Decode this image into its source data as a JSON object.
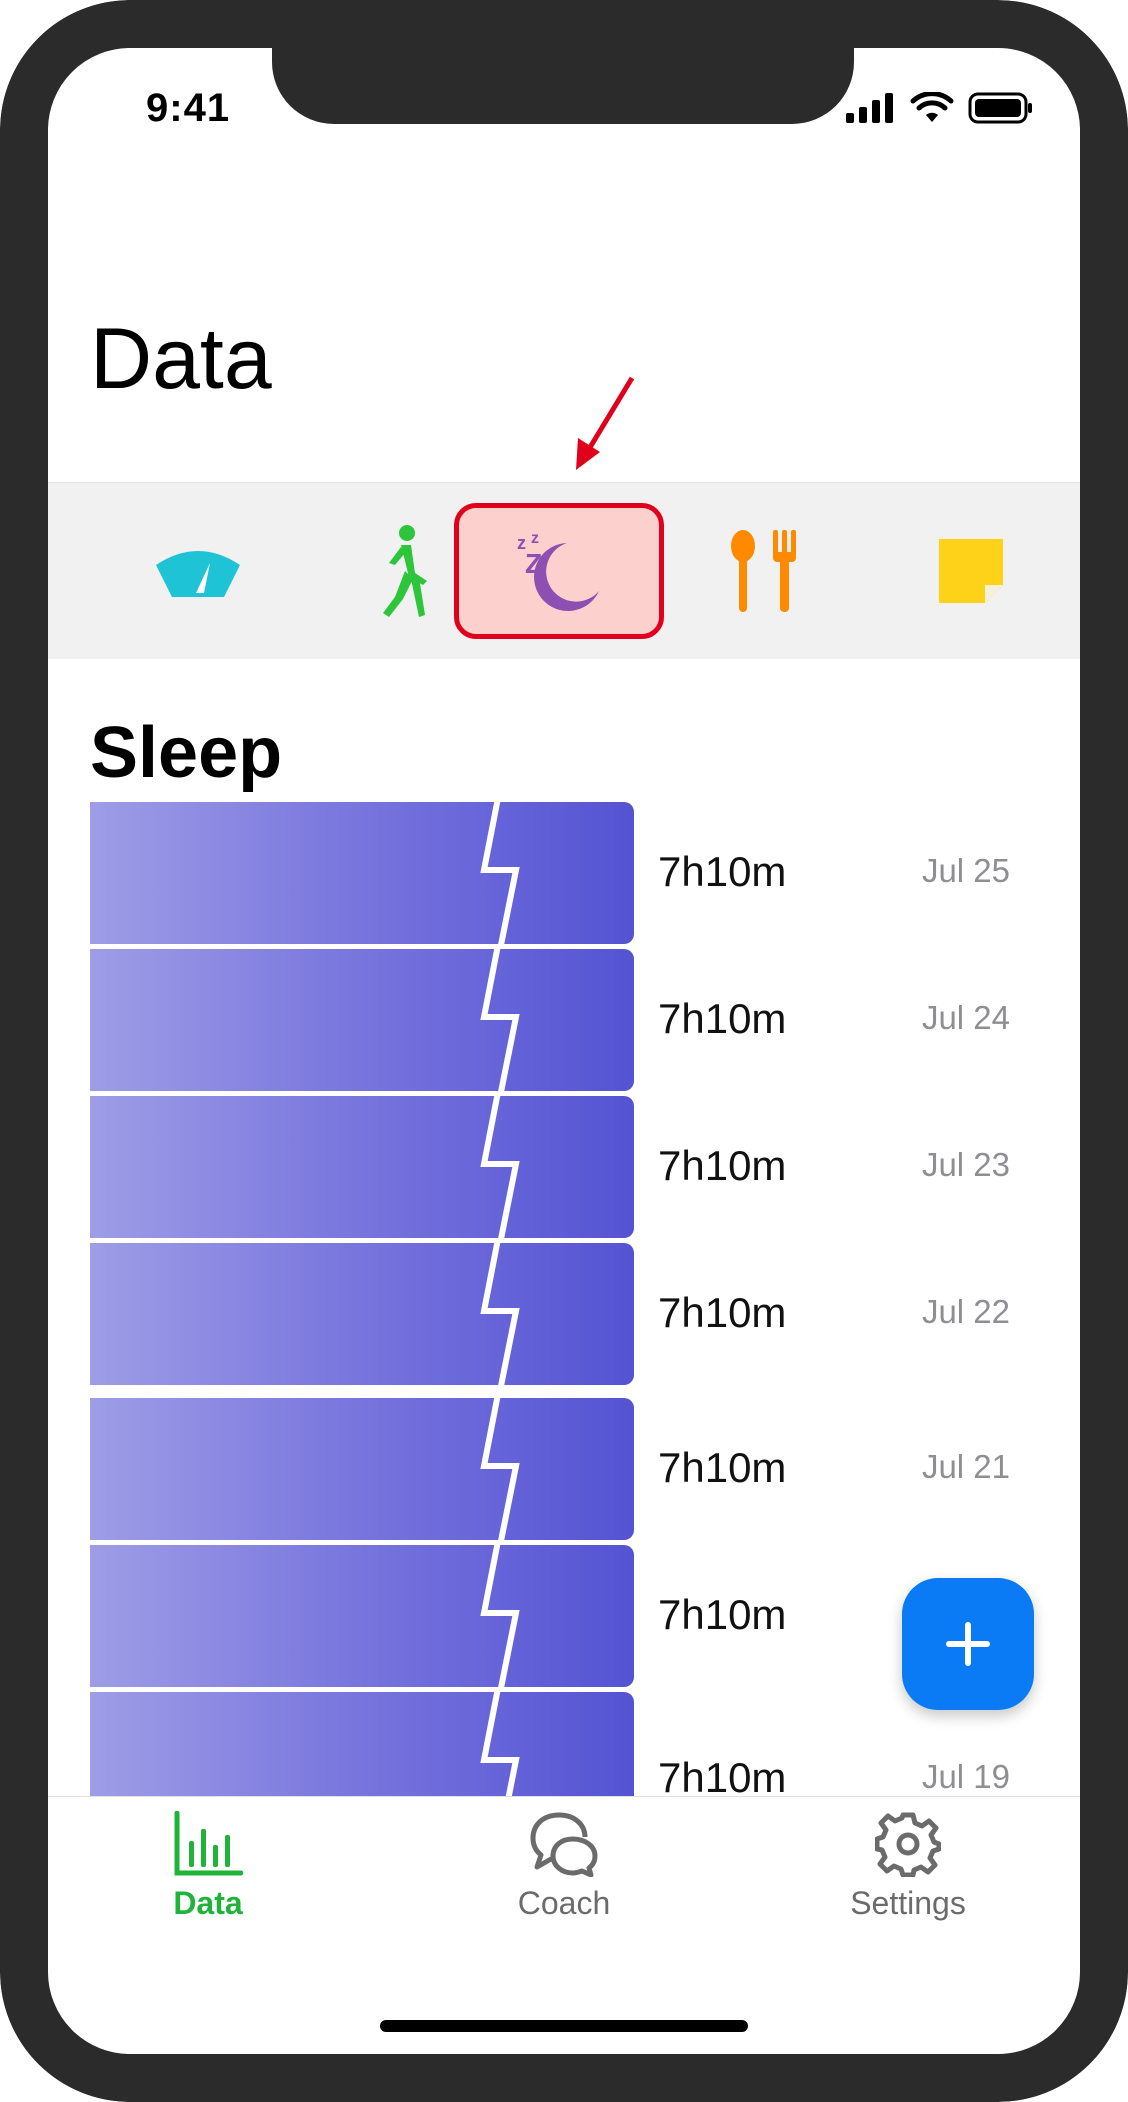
{
  "status_bar": {
    "time": "9:41"
  },
  "header": {
    "title": "Data"
  },
  "categories": [
    {
      "name": "weight",
      "icon": "scale-icon",
      "color": "#1ec3d6",
      "selected": false
    },
    {
      "name": "activity",
      "icon": "walking-icon",
      "color": "#2dc53a",
      "selected": false
    },
    {
      "name": "sleep",
      "icon": "sleep-moon-icon",
      "color": "#8e4fb3",
      "selected": true
    },
    {
      "name": "food",
      "icon": "fork-spoon-icon",
      "color": "#ff8a00",
      "selected": false
    },
    {
      "name": "notes",
      "icon": "sticky-note-icon",
      "color": "#ffd21a",
      "selected": false
    }
  ],
  "section": {
    "title": "Sleep"
  },
  "sleep_entries": [
    {
      "duration": "7h10m",
      "date": "Jul 25"
    },
    {
      "duration": "7h10m",
      "date": "Jul 24"
    },
    {
      "duration": "7h10m",
      "date": "Jul 23"
    },
    {
      "duration": "7h10m",
      "date": "Jul 22"
    },
    {
      "duration": "7h10m",
      "date": "Jul 21"
    },
    {
      "duration": "7h10m",
      "date": ""
    },
    {
      "duration": "7h10m",
      "date": "Jul 19"
    }
  ],
  "tab_bar": {
    "data": {
      "label": "Data",
      "active": true,
      "color": "#1fb33a"
    },
    "coach": {
      "label": "Coach",
      "active": false,
      "color": "#6b6b6b"
    },
    "settings": {
      "label": "Settings",
      "active": false,
      "color": "#6b6b6b"
    }
  },
  "colors": {
    "accent_blue": "#0a7bf5",
    "highlight_border": "#e0001b"
  }
}
